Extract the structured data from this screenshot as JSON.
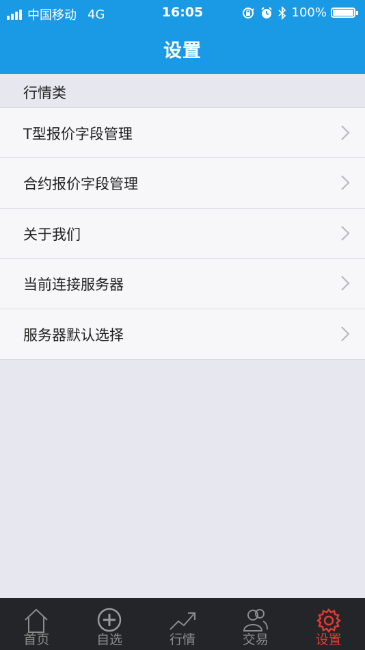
{
  "status_bar": {
    "carrier": "中国移动",
    "network": "4G",
    "time": "16:05",
    "battery": "100%"
  },
  "header": {
    "title": "设置"
  },
  "section": {
    "title": "行情类"
  },
  "rows": [
    {
      "label": "T型报价字段管理"
    },
    {
      "label": "合约报价字段管理"
    },
    {
      "label": "关于我们"
    },
    {
      "label": "当前连接服务器"
    },
    {
      "label": "服务器默认选择"
    }
  ],
  "tabs": [
    {
      "label": "首页",
      "icon": "home-icon"
    },
    {
      "label": "自选",
      "icon": "add-circle-icon"
    },
    {
      "label": "行情",
      "icon": "trend-up-icon"
    },
    {
      "label": "交易",
      "icon": "users-icon"
    },
    {
      "label": "设置",
      "icon": "gear-icon",
      "active": true
    }
  ],
  "colors": {
    "header_bg": "#1a9ae4",
    "tabbar_bg": "#232528",
    "active_tab": "#e23b36",
    "inactive_tab": "#8c8c8c"
  }
}
